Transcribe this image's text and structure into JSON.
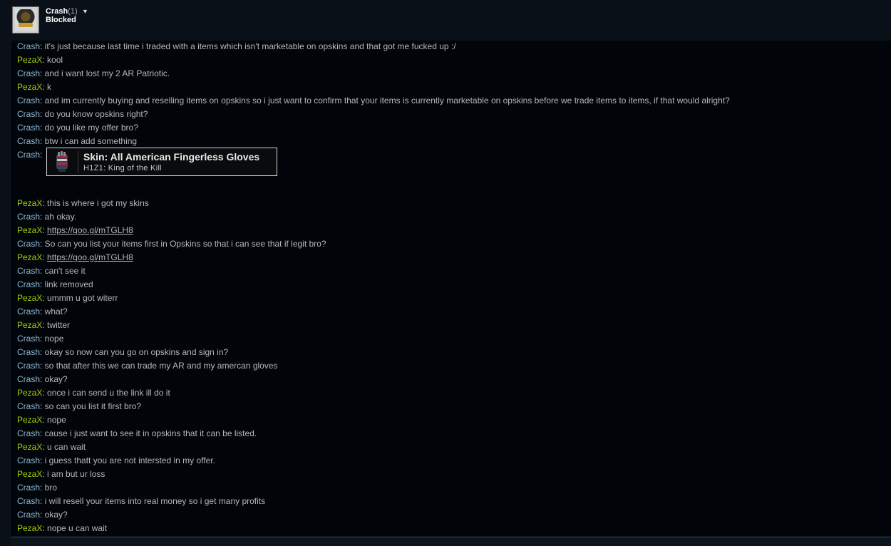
{
  "header": {
    "friend_name": "Crash",
    "friend_count": "(1)",
    "menu_icon": "caret-down-icon",
    "status": "Blocked"
  },
  "item_card": {
    "title": "Skin: All American Fingerless Gloves",
    "game": "H1Z1: King of the Kill",
    "icon": "glove-icon"
  },
  "messages": [
    {
      "sender": "Crash",
      "text": ": it's just because last time i traded with a items which isn't marketable on opskins and that got me fucked up :/"
    },
    {
      "sender": "PezaX",
      "text": ": kool"
    },
    {
      "sender": "Crash",
      "text": ": and i want lost my 2 AR Patriotic."
    },
    {
      "sender": "PezaX",
      "text": ": k"
    },
    {
      "sender": "Crash",
      "text": ": and im currently buying and reselling items on opskins so i just want to confirm that your items is currently marketable on opskins before we trade items to items, if that would alright?"
    },
    {
      "sender": "Crash",
      "text": ": do you know opskins right?"
    },
    {
      "sender": "Crash",
      "text": ": do you like my offer bro?"
    },
    {
      "sender": "Crash",
      "text": ": btw i can add something"
    },
    {
      "sender": "Crash",
      "text": ":"
    },
    {
      "sender": "PezaX",
      "text": ": this is where i got my skins"
    },
    {
      "sender": "Crash",
      "text": ": ah okay."
    },
    {
      "sender": "PezaX",
      "text": ": ",
      "link": "https://goo.gl/mTGLH8"
    },
    {
      "sender": "Crash",
      "text": ": So can you list your items first in Opskins so that i can see that if legit bro?"
    },
    {
      "sender": "PezaX",
      "text": ": ",
      "link": "https://goo.gl/mTGLH8"
    },
    {
      "sender": "Crash",
      "text": ": can't see it"
    },
    {
      "sender": "Crash",
      "text": ": link removed"
    },
    {
      "sender": "PezaX",
      "text": ": ummm u got witerr"
    },
    {
      "sender": "Crash",
      "text": ": what?"
    },
    {
      "sender": "PezaX",
      "text": ": twitter"
    },
    {
      "sender": "Crash",
      "text": ": nope"
    },
    {
      "sender": "Crash",
      "text": ": okay so now can you go on opskins and sign in?"
    },
    {
      "sender": "Crash",
      "text": ": so that after this we can trade my AR and my amercan gloves"
    },
    {
      "sender": "Crash",
      "text": ": okay?"
    },
    {
      "sender": "PezaX",
      "text": ": once i can send u the link ill do it"
    },
    {
      "sender": "Crash",
      "text": ": so can you list it first bro?"
    },
    {
      "sender": "PezaX",
      "text": ": nope"
    },
    {
      "sender": "Crash",
      "text": ": cause i just want to see it in opskins that it can be listed."
    },
    {
      "sender": "PezaX",
      "text": ": u can wait"
    },
    {
      "sender": "Crash",
      "text": ": i guess thatt you are not intersted in my offer."
    },
    {
      "sender": "PezaX",
      "text": ": i am but ur loss"
    },
    {
      "sender": "Crash",
      "text": ": bro"
    },
    {
      "sender": "Crash",
      "text": ": i will resell your items into real money so i get many profits"
    },
    {
      "sender": "Crash",
      "text": ": okay?"
    },
    {
      "sender": "PezaX",
      "text": ": nope u can wait"
    }
  ]
}
